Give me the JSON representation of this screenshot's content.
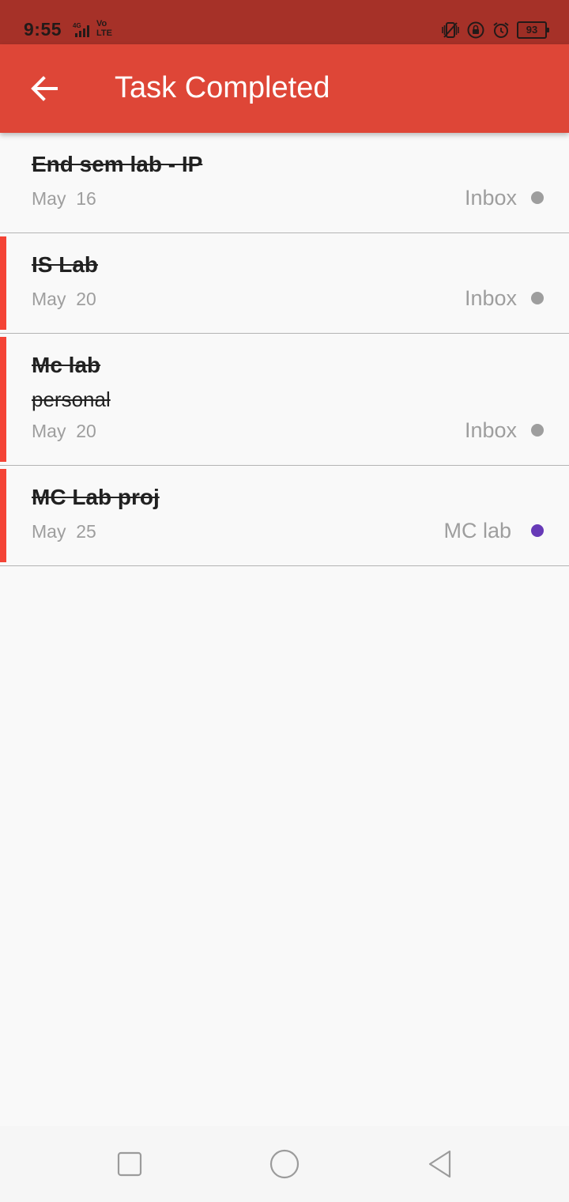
{
  "status_bar": {
    "time": "9:55",
    "network": "4G",
    "volte_top": "Vo",
    "volte_bottom": "LTE",
    "battery": "93"
  },
  "app_bar": {
    "title": "Task Completed",
    "color": "#de4637"
  },
  "tasks": [
    {
      "title": "End sem lab - IP",
      "note": "",
      "date": "May  16",
      "project": "Inbox",
      "project_color": "#9e9e9e",
      "priority_color": "none"
    },
    {
      "title": "IS Lab ",
      "note": "",
      "date": "May  20",
      "project": "Inbox",
      "project_color": "#9e9e9e",
      "priority_color": "#f44436"
    },
    {
      "title": "Mc lab",
      "note": "personal",
      "date": "May  20",
      "project": "Inbox",
      "project_color": "#9e9e9e",
      "priority_color": "#f44436"
    },
    {
      "title": "MC Lab proj",
      "note": "",
      "date": "May  25",
      "project": "MC lab",
      "project_color": "#673ab7",
      "priority_color": "#f44436"
    }
  ],
  "nav_bar": {
    "icons": [
      "recents-icon",
      "home-icon",
      "back-icon"
    ]
  }
}
